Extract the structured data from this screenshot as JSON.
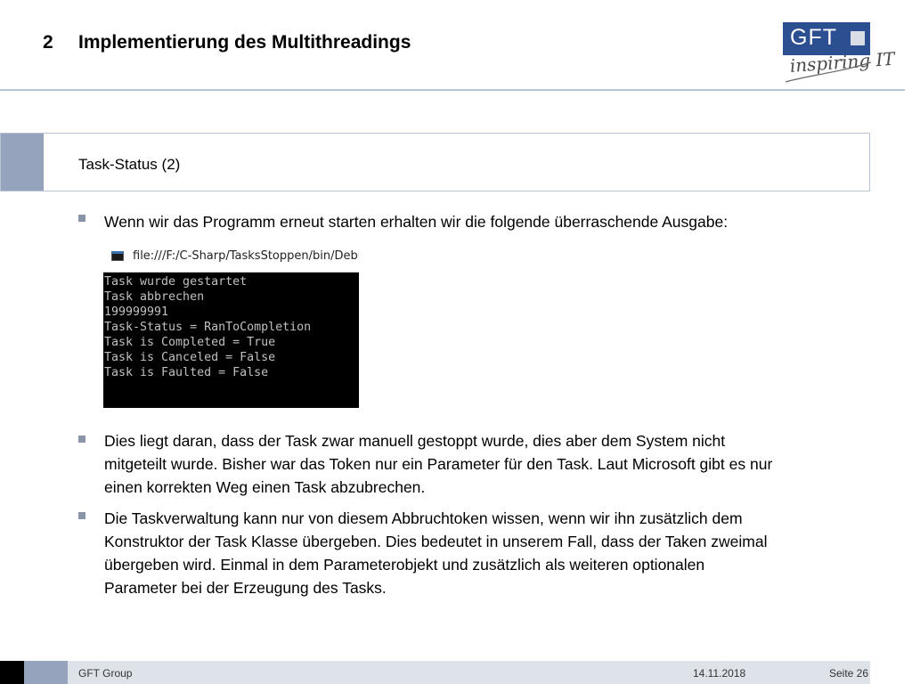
{
  "header": {
    "number": "2",
    "title": "Implementierung des Multithreadings"
  },
  "logo": {
    "text": "GFT",
    "tagline": "inspiring IT",
    "color": "#2b4f91"
  },
  "section": {
    "title": "Task-Status (2)"
  },
  "bullets": [
    {
      "text": "Wenn wir das Programm erneut starten erhalten wir die folgende überraschende Ausgabe:"
    },
    {
      "lines": [
        "Dies liegt daran, dass der Task zwar manuell gestoppt wurde, dies aber dem System nicht",
        "mitgeteilt wurde. Bisher war das Token nur ein Parameter für den Task. Laut Microsoft gibt es nur",
        "einen korrekten Weg einen Task abzubrechen."
      ]
    },
    {
      "lines": [
        "Die Taskverwaltung kann nur von diesem Abbruchtoken wissen, wenn wir ihn zusätzlich dem",
        "Konstruktor der Task Klasse übergeben. Dies bedeutet in unserem Fall, dass der Taken zweimal",
        "übergeben wird. Einmal in dem Parameterobjekt und zusätzlich als weiteren optionalen",
        "Parameter bei der Erzeugung des Tasks."
      ]
    }
  ],
  "console": {
    "path": "file:///F:/C-Sharp/TasksStoppen/bin/Debug/",
    "lines": [
      "Task wurde gestartet",
      "Task abbrechen",
      "199999991",
      "Task-Status = RanToCompletion",
      "Task is Completed = True",
      "Task is Canceled = False",
      "Task is Faulted = False"
    ]
  },
  "footer": {
    "company": "GFT Group",
    "date": "14.11.2018",
    "page": "Seite 26"
  }
}
